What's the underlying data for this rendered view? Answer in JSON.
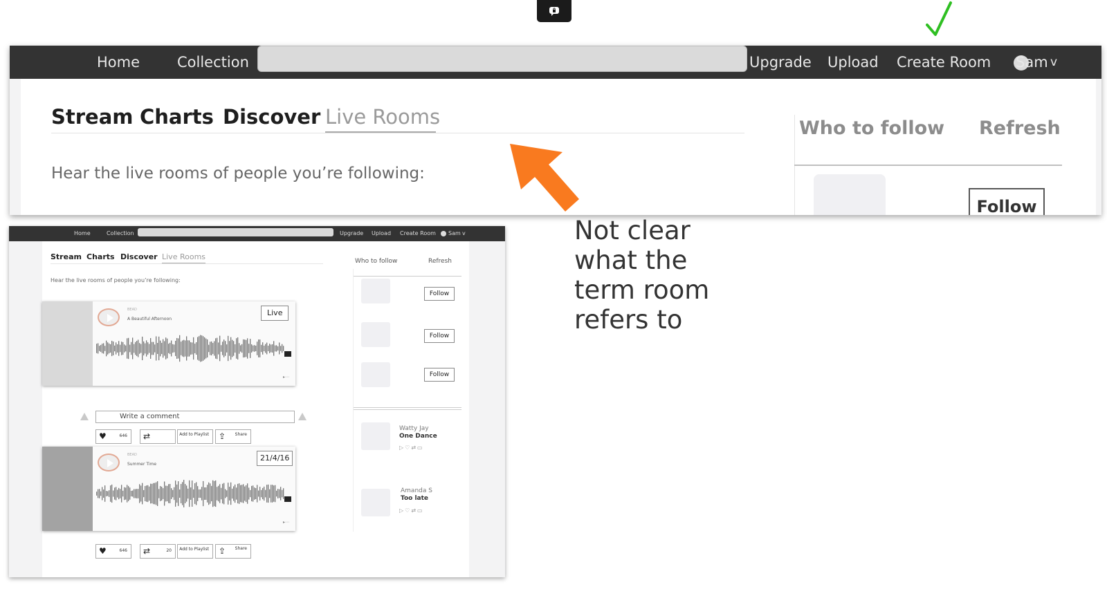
{
  "zoom": {
    "nav": {
      "home": "Home",
      "collection": "Collection",
      "upgrade": "Upgrade",
      "upload": "Upload",
      "create_room": "Create Room",
      "user": "Sam",
      "user_caret": "v"
    },
    "tabs": [
      "Stream",
      "Charts",
      "Discover",
      "Live Rooms"
    ],
    "subtitle": "Hear the live rooms of people you’re following:",
    "who_to_follow": "Who to follow",
    "refresh": "Refresh",
    "follow": "Follow"
  },
  "annotation": {
    "note": "Not clear what the term room refers to",
    "arrow_color": "#f97a1f",
    "check_color": "#2fbf22"
  },
  "mini": {
    "nav": {
      "home": "Home",
      "collection": "Collection",
      "upgrade": "Upgrade",
      "upload": "Upload",
      "create_room": "Create Room",
      "user": "Sam",
      "user_caret": "v"
    },
    "tabs": [
      "Stream",
      "Charts",
      "Discover",
      "Live Rooms"
    ],
    "subtitle": "Hear the live rooms of people you’re following:",
    "cards": [
      {
        "artist": "BEAD",
        "track": "A Beautiful Afternoon",
        "tag": "Live"
      },
      {
        "artist": "BEAD",
        "track": "Summer Time",
        "tag": "21/4/16"
      }
    ],
    "comment_placeholder": "Write a comment",
    "actions": [
      {
        "likes": "646",
        "reposts": "",
        "playlist": "Add to Playlist",
        "share": "Share"
      },
      {
        "likes": "646",
        "reposts": "20",
        "playlist": "Add to Playlist",
        "share": "Share"
      }
    ],
    "who_to_follow": "Who to follow",
    "refresh": "Refresh",
    "follow": "Follow",
    "suggested": [
      {
        "name": "Watty Jay",
        "track": "One Dance"
      },
      {
        "name": "Amanda S",
        "track": "Too late"
      }
    ]
  }
}
